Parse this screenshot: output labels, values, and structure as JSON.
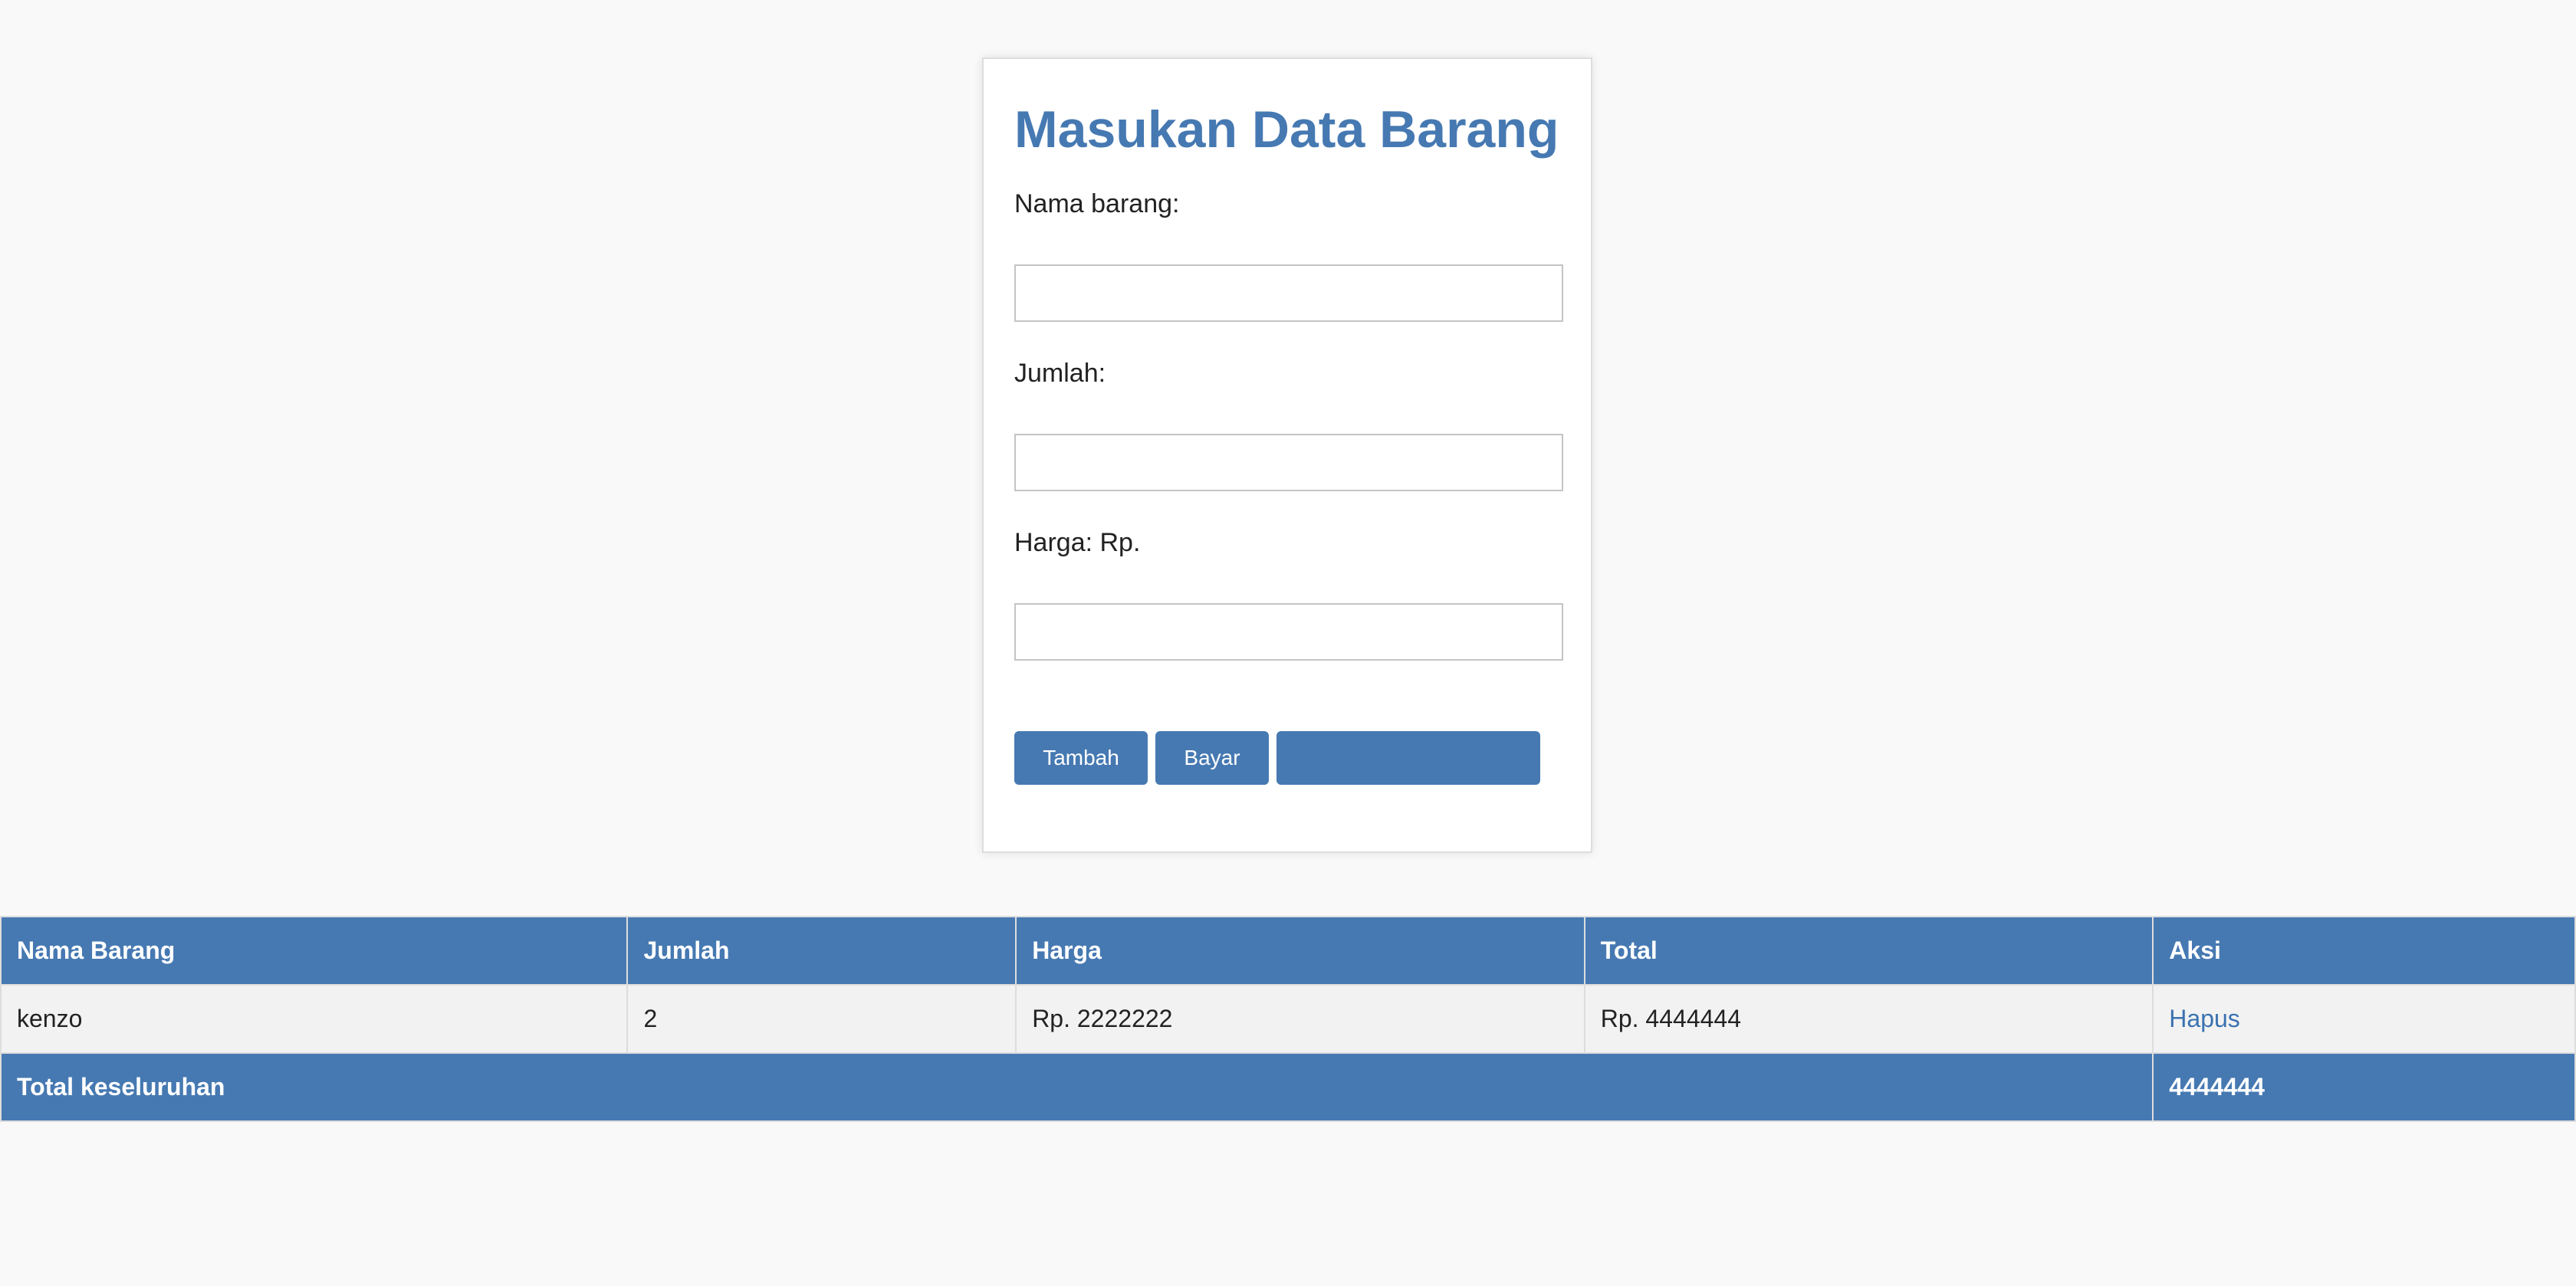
{
  "form": {
    "title": "Masukan Data Barang",
    "fields": [
      {
        "label": "Nama barang:",
        "value": "",
        "placeholder": ""
      },
      {
        "label": "Jumlah:",
        "value": "",
        "placeholder": ""
      },
      {
        "label": "Harga: Rp.",
        "value": "",
        "placeholder": ""
      }
    ],
    "buttons": {
      "tambah": "Tambah",
      "bayar": "Bayar",
      "blank": ""
    }
  },
  "table": {
    "headers": [
      "Nama Barang",
      "Jumlah",
      "Harga",
      "Total",
      "Aksi"
    ],
    "rows": [
      {
        "nama": "kenzo",
        "jumlah": "2",
        "harga": "Rp. 2222222",
        "total": "Rp. 4444444",
        "aksi": "Hapus"
      }
    ],
    "footer": {
      "label": "Total keseluruhan",
      "value": "4444444"
    }
  },
  "colors": {
    "accent": "#4679b2",
    "background": "#f9f9f9",
    "row_background": "#f2f2f2",
    "link": "#3a72b0"
  }
}
